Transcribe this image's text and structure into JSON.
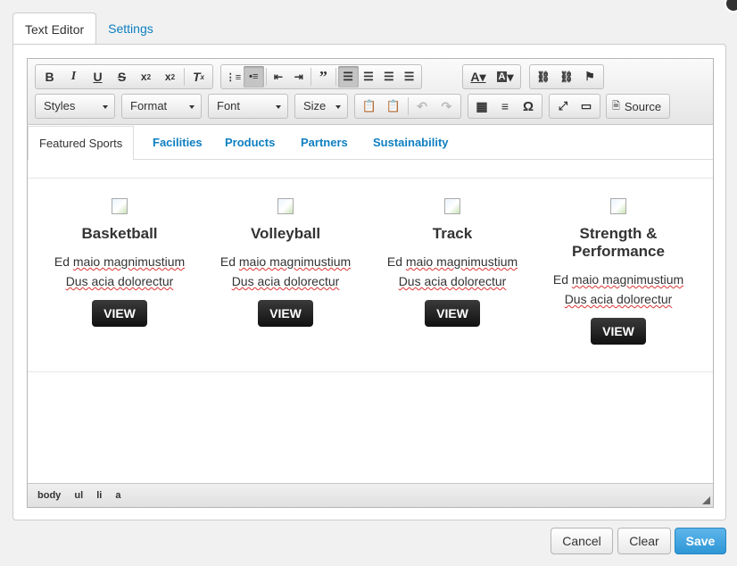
{
  "dialog": {
    "tabs": [
      {
        "label": "Text Editor"
      },
      {
        "label": "Settings"
      }
    ]
  },
  "toolbar": {
    "styles_label": "Styles",
    "format_label": "Format",
    "font_label": "Font",
    "size_label": "Size",
    "source_label": "Source"
  },
  "content": {
    "tabs": [
      {
        "label": "Featured Sports"
      },
      {
        "label": "Facilities"
      },
      {
        "label": "Products"
      },
      {
        "label": "Partners"
      },
      {
        "label": "Sustainability"
      }
    ],
    "cards": [
      {
        "title": "Basketball",
        "line1a": "Ed ",
        "line1b": "maio magnimustium",
        "line2": "Dus acia dolorectur",
        "button": "VIEW"
      },
      {
        "title": "Volleyball",
        "line1a": "Ed ",
        "line1b": "maio magnimustium",
        "line2": "Dus acia dolorectur",
        "button": "VIEW"
      },
      {
        "title": "Track",
        "line1a": "Ed ",
        "line1b": "maio magnimustium",
        "line2": "Dus acia dolorectur",
        "button": "VIEW"
      },
      {
        "title": "Strength & Performance",
        "line1a": "Ed ",
        "line1b": "maio magnimustium",
        "line2": "Dus acia dolorectur",
        "button": "VIEW"
      }
    ]
  },
  "statusbar": {
    "path": [
      "body",
      "ul",
      "li",
      "a"
    ]
  },
  "footer": {
    "cancel_label": "Cancel",
    "clear_label": "Clear",
    "save_label": "Save"
  },
  "colors": {
    "link": "#0e7fc1",
    "save_button": "#2e96d6",
    "view_button": "#222222"
  }
}
